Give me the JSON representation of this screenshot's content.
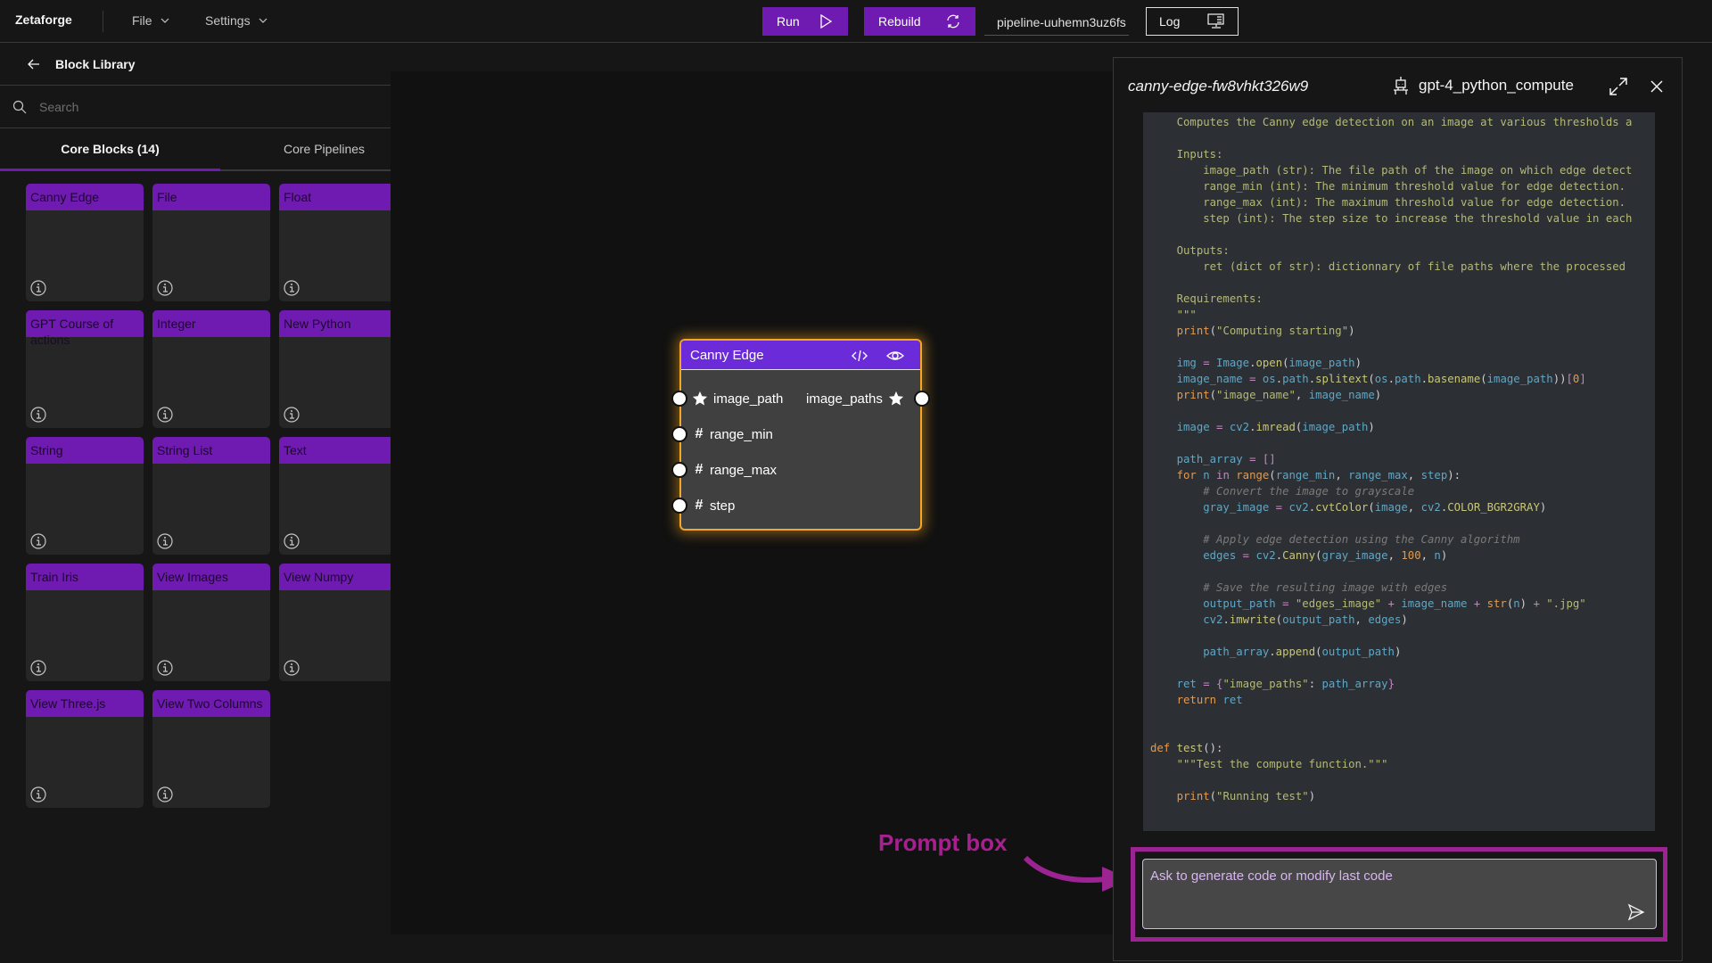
{
  "topbar": {
    "brand": "Zetaforge",
    "menus": [
      {
        "label": "File"
      },
      {
        "label": "Settings"
      }
    ],
    "run_label": "Run",
    "rebuild_label": "Rebuild",
    "pipeline_name": "pipeline-uuhemn3uz6fs",
    "log_label": "Log"
  },
  "sidebar": {
    "title": "Block Library",
    "search_placeholder": "Search",
    "tabs": [
      {
        "label": "Core Blocks (14)",
        "active": true
      },
      {
        "label": "Core Pipelines",
        "active": false
      }
    ],
    "blocks": [
      {
        "label": "Canny Edge"
      },
      {
        "label": "File"
      },
      {
        "label": "Float"
      },
      {
        "label": "GPT Course of actions"
      },
      {
        "label": "Integer"
      },
      {
        "label": "New Python"
      },
      {
        "label": "String"
      },
      {
        "label": "String List"
      },
      {
        "label": "Text"
      },
      {
        "label": "Train Iris"
      },
      {
        "label": "View Images"
      },
      {
        "label": "View Numpy"
      },
      {
        "label": "View Three.js"
      },
      {
        "label": "View Two Columns"
      }
    ]
  },
  "canvas": {
    "node": {
      "title": "Canny Edge",
      "inputs": [
        {
          "name": "image_path",
          "icon": "star"
        },
        {
          "name": "range_min",
          "icon": "hash"
        },
        {
          "name": "range_max",
          "icon": "hash"
        },
        {
          "name": "step",
          "icon": "hash"
        }
      ],
      "outputs": [
        {
          "name": "image_paths",
          "icon": "star"
        }
      ]
    }
  },
  "annotation": {
    "label": "Prompt box",
    "color": "#9c2492"
  },
  "panel": {
    "block_id": "canny-edge-fw8vhkt326w9",
    "model": "gpt-4_python_compute",
    "code_lines": [
      [
        [
          "doc",
          "    Computes the Canny edge detection on an image at various thresholds a"
        ]
      ],
      [],
      [
        [
          "doc",
          "    Inputs:"
        ]
      ],
      [
        [
          "doc",
          "        image_path (str): The file path of the image on which edge detect"
        ]
      ],
      [
        [
          "doc",
          "        range_min (int): The minimum threshold value for edge detection."
        ]
      ],
      [
        [
          "doc",
          "        range_max (int): The maximum threshold value for edge detection."
        ]
      ],
      [
        [
          "doc",
          "        step (int): The step size to increase the threshold value in each"
        ]
      ],
      [],
      [
        [
          "doc",
          "    Outputs:"
        ]
      ],
      [
        [
          "doc",
          "        ret (dict of str): dictionnary of file paths where the processed"
        ]
      ],
      [],
      [
        [
          "doc",
          "    Requirements:"
        ]
      ],
      [
        [
          "doc",
          "    \"\"\""
        ]
      ],
      [
        [
          "kw",
          "    print"
        ],
        [
          "pun",
          "("
        ],
        [
          "str",
          "\"Computing starting\""
        ],
        [
          "pun",
          ")"
        ]
      ],
      [],
      [
        [
          "var",
          "    img "
        ],
        [
          "op",
          "= "
        ],
        [
          "var",
          "Image"
        ],
        [
          "pun",
          "."
        ],
        [
          "fn",
          "open"
        ],
        [
          "pun",
          "("
        ],
        [
          "var",
          "image_path"
        ],
        [
          "pun",
          ")"
        ]
      ],
      [
        [
          "var",
          "    image_name "
        ],
        [
          "op",
          "= "
        ],
        [
          "var",
          "os"
        ],
        [
          "pun",
          "."
        ],
        [
          "var",
          "path"
        ],
        [
          "pun",
          "."
        ],
        [
          "fn",
          "splitext"
        ],
        [
          "pun",
          "("
        ],
        [
          "var",
          "os"
        ],
        [
          "pun",
          "."
        ],
        [
          "var",
          "path"
        ],
        [
          "pun",
          "."
        ],
        [
          "fn",
          "basename"
        ],
        [
          "pun",
          "("
        ],
        [
          "var",
          "image_path"
        ],
        [
          "pun",
          "))"
        ],
        [
          "br",
          "["
        ],
        [
          "num",
          "0"
        ],
        [
          "br",
          "]"
        ]
      ],
      [
        [
          "kw",
          "    print"
        ],
        [
          "pun",
          "("
        ],
        [
          "str",
          "\"image_name\""
        ],
        [
          "pun",
          ", "
        ],
        [
          "var",
          "image_name"
        ],
        [
          "pun",
          ")"
        ]
      ],
      [],
      [
        [
          "var",
          "    image "
        ],
        [
          "op",
          "= "
        ],
        [
          "var",
          "cv2"
        ],
        [
          "pun",
          "."
        ],
        [
          "fn",
          "imread"
        ],
        [
          "pun",
          "("
        ],
        [
          "var",
          "image_path"
        ],
        [
          "pun",
          ")"
        ]
      ],
      [],
      [
        [
          "var",
          "    path_array "
        ],
        [
          "op",
          "= "
        ],
        [
          "br",
          "[]"
        ]
      ],
      [
        [
          "kw",
          "    for "
        ],
        [
          "var",
          "n "
        ],
        [
          "op",
          "in "
        ],
        [
          "kw",
          "range"
        ],
        [
          "pun",
          "("
        ],
        [
          "var",
          "range_min"
        ],
        [
          "pun",
          ", "
        ],
        [
          "var",
          "range_max"
        ],
        [
          "pun",
          ", "
        ],
        [
          "var",
          "step"
        ],
        [
          "pun",
          "):"
        ]
      ],
      [
        [
          "com",
          "        # Convert the image to grayscale"
        ]
      ],
      [
        [
          "var",
          "        gray_image "
        ],
        [
          "op",
          "= "
        ],
        [
          "var",
          "cv2"
        ],
        [
          "pun",
          "."
        ],
        [
          "fn",
          "cvtColor"
        ],
        [
          "pun",
          "("
        ],
        [
          "var",
          "image"
        ],
        [
          "pun",
          ", "
        ],
        [
          "var",
          "cv2"
        ],
        [
          "pun",
          "."
        ],
        [
          "fn",
          "COLOR_BGR2GRAY"
        ],
        [
          "pun",
          ")"
        ]
      ],
      [],
      [
        [
          "com",
          "        # Apply edge detection using the Canny algorithm"
        ]
      ],
      [
        [
          "var",
          "        edges "
        ],
        [
          "op",
          "= "
        ],
        [
          "var",
          "cv2"
        ],
        [
          "pun",
          "."
        ],
        [
          "fn",
          "Canny"
        ],
        [
          "pun",
          "("
        ],
        [
          "var",
          "gray_image"
        ],
        [
          "pun",
          ", "
        ],
        [
          "num",
          "100"
        ],
        [
          "pun",
          ", "
        ],
        [
          "var",
          "n"
        ],
        [
          "pun",
          ")"
        ]
      ],
      [],
      [
        [
          "com",
          "        # Save the resulting image with edges"
        ]
      ],
      [
        [
          "var",
          "        output_path "
        ],
        [
          "op",
          "= "
        ],
        [
          "str",
          "\"edges_image\" "
        ],
        [
          "op",
          "+ "
        ],
        [
          "var",
          "image_name "
        ],
        [
          "op",
          "+ "
        ],
        [
          "kw",
          "str"
        ],
        [
          "pun",
          "("
        ],
        [
          "var",
          "n"
        ],
        [
          "pun",
          ") "
        ],
        [
          "op",
          "+ "
        ],
        [
          "str",
          "\".jpg\""
        ]
      ],
      [
        [
          "var",
          "        cv2"
        ],
        [
          "pun",
          "."
        ],
        [
          "fn",
          "imwrite"
        ],
        [
          "pun",
          "("
        ],
        [
          "var",
          "output_path"
        ],
        [
          "pun",
          ", "
        ],
        [
          "var",
          "edges"
        ],
        [
          "pun",
          ")"
        ]
      ],
      [],
      [
        [
          "var",
          "        path_array"
        ],
        [
          "pun",
          "."
        ],
        [
          "fn",
          "append"
        ],
        [
          "pun",
          "("
        ],
        [
          "var",
          "output_path"
        ],
        [
          "pun",
          ")"
        ]
      ],
      [],
      [
        [
          "var",
          "    ret "
        ],
        [
          "op",
          "= "
        ],
        [
          "br",
          "{"
        ],
        [
          "str",
          "\"image_paths\""
        ],
        [
          "pun",
          ": "
        ],
        [
          "var",
          "path_array"
        ],
        [
          "br",
          "}"
        ]
      ],
      [
        [
          "kw",
          "    return "
        ],
        [
          "var",
          "ret"
        ]
      ],
      [],
      [],
      [
        [
          "kw",
          "def "
        ],
        [
          "fn",
          "test"
        ],
        [
          "pun",
          "():"
        ]
      ],
      [
        [
          "doc",
          "    \"\"\"Test the compute function.\"\"\""
        ]
      ],
      [],
      [
        [
          "kw",
          "    print"
        ],
        [
          "pun",
          "("
        ],
        [
          "str",
          "\"Running test\""
        ],
        [
          "pun",
          ")"
        ]
      ]
    ],
    "prompt_placeholder": "Ask to generate code or modify last code",
    "prompt_value": ""
  },
  "colors": {
    "accent": "#6f1ab0",
    "node_header": "#6c2bd9",
    "node_selected_border": "#f5a623",
    "annotation": "#9c2492"
  }
}
